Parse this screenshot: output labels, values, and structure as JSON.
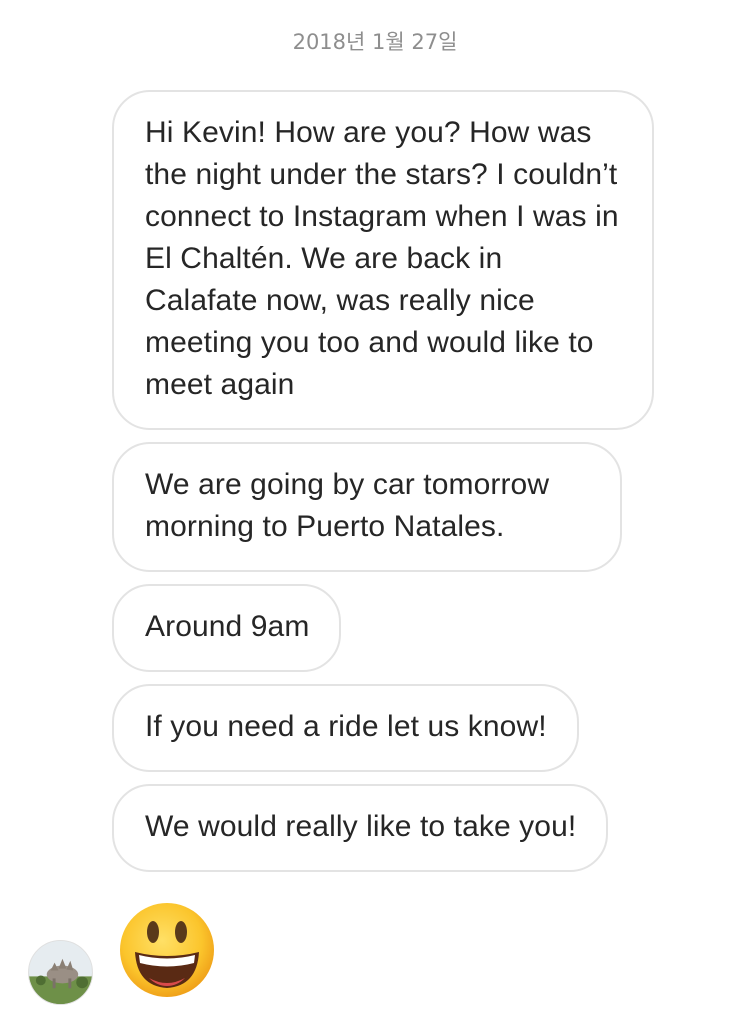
{
  "header": {
    "timestamp": "2018년 1월 27일"
  },
  "messages": [
    {
      "text": "Hi Kevin! How are you? How was the night under the stars? I couldn’t connect to Instagram when I was in El Chaltén. We are back in Calafate now, was really nice meeting you too and would like to meet again"
    },
    {
      "text": "We are going by car tomorrow morning to Puerto Natales."
    },
    {
      "text": "Around 9am"
    },
    {
      "text": "If you need a ride let us know!"
    },
    {
      "text": "We would really like to take you!"
    }
  ],
  "reaction": {
    "icon": "grinning-face-emoji"
  },
  "sender": {
    "avatar_icon": "profile-photo"
  },
  "colors": {
    "bubble_border": "#e3e3e3",
    "text": "#262626",
    "timestamp": "#8e8e8e"
  }
}
